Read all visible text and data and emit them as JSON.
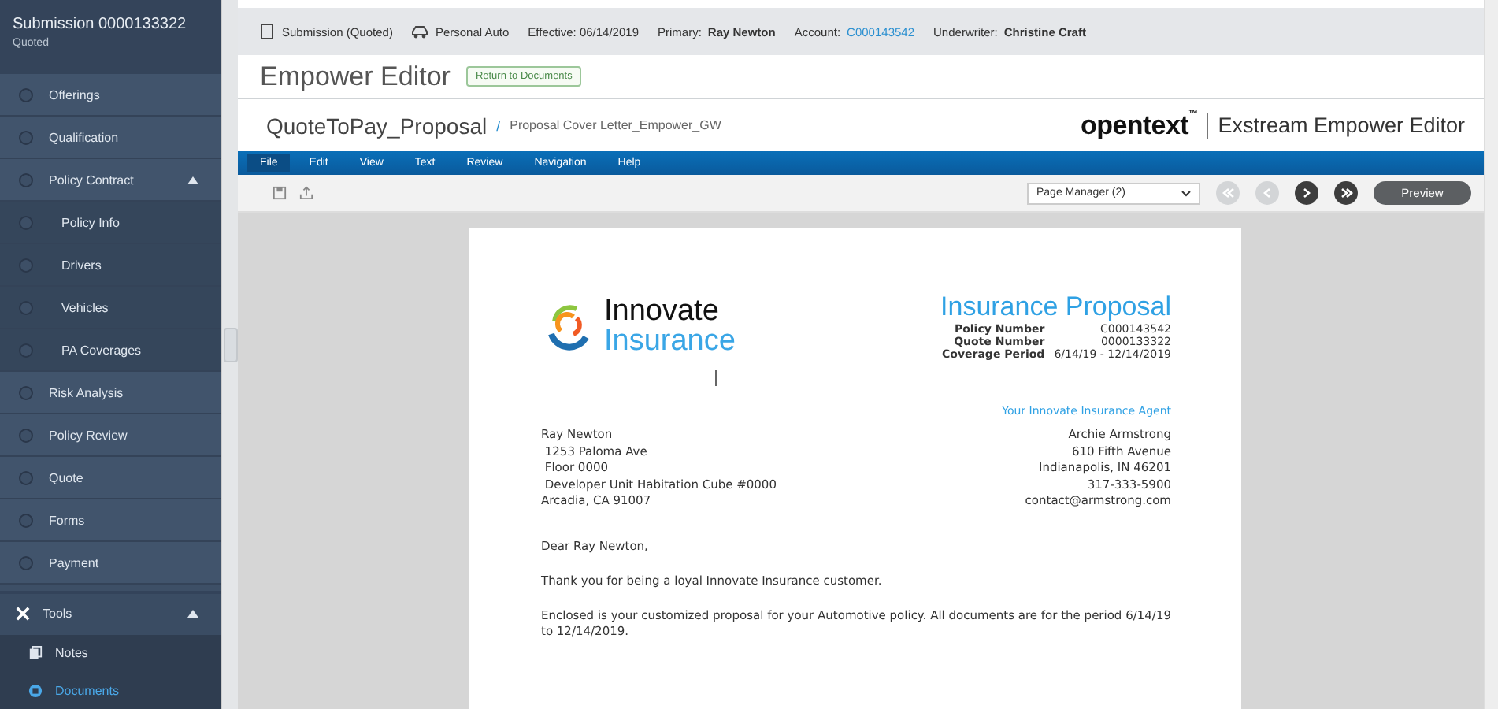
{
  "sidebar": {
    "title": "Submission 0000133322",
    "status": "Quoted",
    "steps": [
      {
        "label": "Offerings"
      },
      {
        "label": "Qualification"
      },
      {
        "label": "Policy Contract",
        "expanded": true,
        "children": [
          {
            "label": "Policy Info",
            "selected": false
          },
          {
            "label": "Drivers",
            "selected": false
          },
          {
            "label": "Vehicles",
            "selected": false
          },
          {
            "label": "PA Coverages",
            "selected": false
          }
        ]
      },
      {
        "label": "Risk Analysis"
      },
      {
        "label": "Policy Review"
      },
      {
        "label": "Quote"
      },
      {
        "label": "Forms"
      },
      {
        "label": "Payment"
      }
    ],
    "tools": {
      "label": "Tools",
      "expanded": true,
      "items": [
        {
          "label": "Notes",
          "selected": false,
          "kind": "notes"
        },
        {
          "label": "Documents",
          "selected": true,
          "kind": "documents"
        }
      ]
    }
  },
  "info_bar": {
    "submission": "Submission (Quoted)",
    "product": "Personal Auto",
    "effective": "Effective: 06/14/2019",
    "primary_label": "Primary:",
    "primary": "Ray Newton",
    "account_label": "Account:",
    "account": "C000143542",
    "underwriter_label": "Underwriter:",
    "underwriter": "Christine Craft"
  },
  "editor": {
    "title": "Empower Editor",
    "return_button": "Return to Documents",
    "document": "QuoteToPay_Proposal",
    "separator": "/",
    "template": "Proposal Cover Letter_Empower_GW",
    "brand": "opentext",
    "brand_mark": "™",
    "product": "Exstream Empower Editor",
    "menu": [
      {
        "label": "File",
        "selected": true
      },
      {
        "label": "Edit",
        "selected": false
      },
      {
        "label": "View",
        "selected": false
      },
      {
        "label": "Text",
        "selected": false
      },
      {
        "label": "Review",
        "selected": false
      },
      {
        "label": "Navigation",
        "selected": false
      },
      {
        "label": "Help",
        "selected": false
      }
    ],
    "page_manager": "Page Manager (2)",
    "nav_buttons": [
      {
        "kind": "first",
        "disabled": true
      },
      {
        "kind": "prev",
        "disabled": true
      },
      {
        "kind": "next",
        "disabled": false
      },
      {
        "kind": "last",
        "disabled": false
      }
    ],
    "preview_button": "Preview"
  },
  "letter": {
    "logo_line1": "Innovate",
    "logo_line2": "Insurance",
    "heading": "Insurance Proposal",
    "details": [
      {
        "label": "Policy Number",
        "value": "C000143542"
      },
      {
        "label": "Quote Number",
        "value": "0000133322"
      },
      {
        "label": "Coverage Period",
        "value": "6/14/19 - 12/14/2019"
      }
    ],
    "agent_heading": "Your Innovate Insurance Agent",
    "recipient": [
      "Ray Newton",
      " 1253 Paloma Ave",
      " Floor 0000",
      " Developer Unit Habitation Cube #0000",
      "Arcadia, CA 91007"
    ],
    "agent": [
      "Archie Armstrong",
      "610 Fifth Avenue",
      "Indianapolis, IN 46201",
      "317-333-5900",
      "contact@armstrong.com"
    ],
    "greeting": "Dear Ray Newton,",
    "paragraphs": [
      "Thank you for being a loyal Innovate Insurance customer.",
      "Enclosed is your customized proposal for your Automotive policy. All documents are for the period 6/14/19 to 12/14/2019."
    ]
  }
}
